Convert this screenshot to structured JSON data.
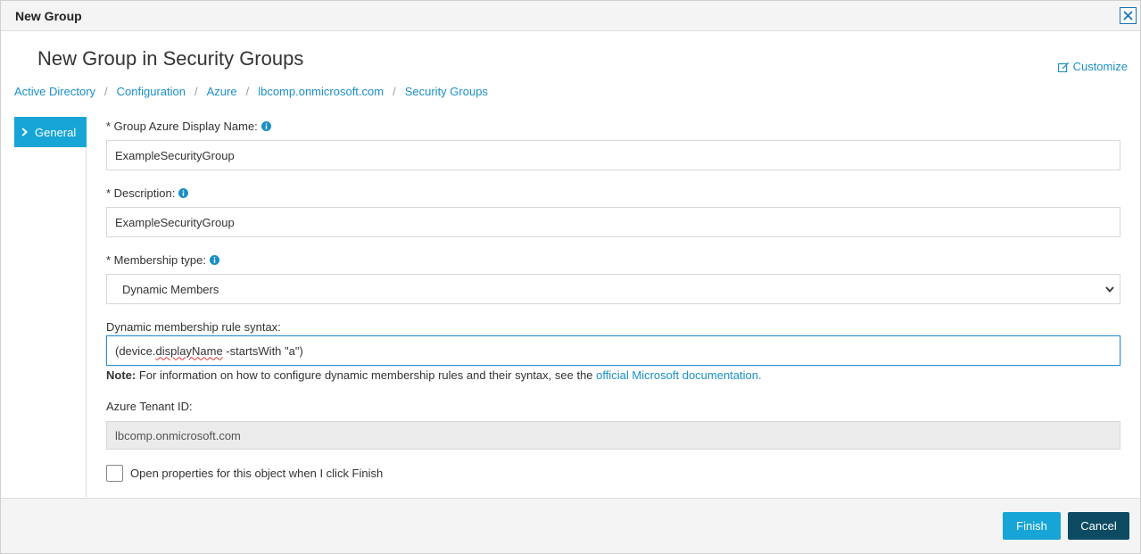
{
  "window": {
    "title": "New Group"
  },
  "header": {
    "page_title": "New Group in Security Groups",
    "customize_label": "Customize"
  },
  "breadcrumb": [
    "Active Directory",
    "Configuration",
    "Azure",
    "lbcomp.onmicrosoft.com",
    "Security Groups"
  ],
  "sidebar": {
    "items": [
      {
        "label": "General"
      }
    ]
  },
  "form": {
    "display_name": {
      "label": "* Group Azure Display Name:",
      "value": "ExampleSecurityGroup"
    },
    "description": {
      "label": "* Description:",
      "value": "ExampleSecurityGroup"
    },
    "membership_type": {
      "label": "* Membership type:",
      "value": "Dynamic Members"
    },
    "rule_syntax": {
      "label": "Dynamic membership rule syntax:",
      "value_part1": "(device.",
      "value_part2": "displayName",
      "value_part3": " -startsWith \"a\")"
    },
    "note": {
      "prefix": "Note:",
      "text": " For information on how to configure dynamic membership rules and their syntax, see the ",
      "link": "official Microsoft documentation."
    },
    "tenant_id": {
      "label": "Azure Tenant ID:",
      "value": "lbcomp.onmicrosoft.com"
    },
    "open_properties": {
      "label": "Open properties for this object when I click Finish",
      "checked": false
    }
  },
  "footer": {
    "finish_label": "Finish",
    "cancel_label": "Cancel"
  },
  "colors": {
    "accent": "#16a5d6",
    "dark_button": "#0d4b63",
    "link": "#1a8fc7"
  }
}
